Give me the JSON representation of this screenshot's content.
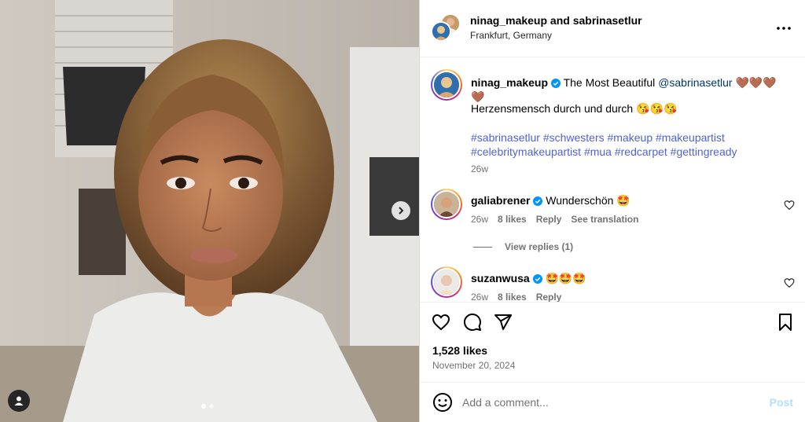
{
  "header": {
    "username": "ninag_makeup",
    "joiner": "and",
    "collaborator": "sabrinasetlur",
    "location": "Frankfurt, Germany"
  },
  "caption": {
    "username": "ninag_makeup",
    "text_prefix": "The Most Beautiful",
    "mention": "@sabrinasetlur",
    "emojis": "🤎🤎🤎🤎",
    "line2": "Herzensmensch durch und durch 😘😘😘",
    "hashtags_line1": "#sabrinasetlur #schwesters #makeup #makeupartist",
    "hashtags_line2": "#celebritymakeupartist #mua #redcarpet #gettingready",
    "time": "26w"
  },
  "comments": [
    {
      "username": "galiabrener",
      "text": "Wunderschön 🤩",
      "time": "26w",
      "likes": "8 likes",
      "reply": "Reply",
      "translation": "See translation",
      "view_replies": "View replies (1)"
    },
    {
      "username": "suzanwusa",
      "text": "🤩🤩🤩",
      "time": "26w",
      "likes": "8 likes",
      "reply": "Reply"
    }
  ],
  "stats": {
    "likes": "1,528 likes",
    "date": "November 20, 2024"
  },
  "composer": {
    "placeholder": "Add a comment...",
    "post_label": "Post"
  },
  "icons": {
    "like": "heart-icon",
    "comment": "comment-icon",
    "share": "send-icon",
    "save": "bookmark-icon",
    "more": "more-icon",
    "emoji": "emoji-icon",
    "next": "chevron-right-icon",
    "tag": "user-tag-icon",
    "verified": "verified-badge-icon"
  },
  "colors": {
    "link": "#00376b",
    "hashtag": "#4f63d2",
    "verified": "#0095f6",
    "post_disabled": "#b2dffc"
  }
}
